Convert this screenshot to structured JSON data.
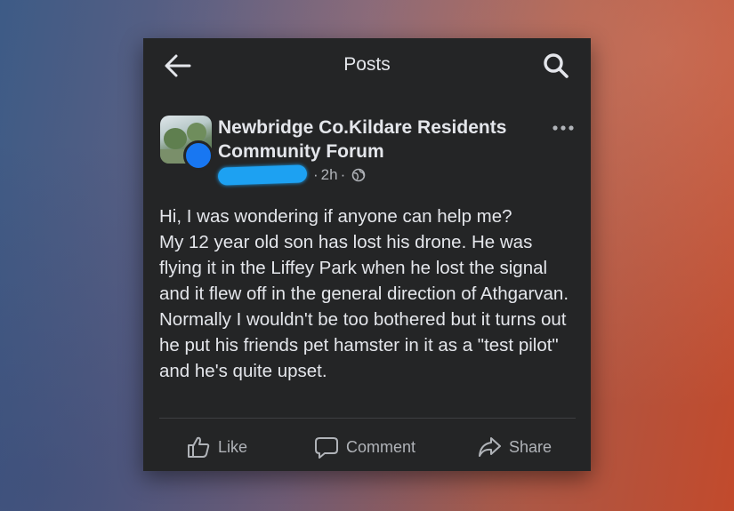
{
  "colors": {
    "card_bg": "#242526",
    "text_primary": "#e4e6eb",
    "text_secondary": "#b0b3b8",
    "accent_blue": "#1877f2",
    "redaction": "#1da1f2"
  },
  "header": {
    "back_icon": "arrow-left-icon",
    "title": "Posts",
    "search_icon": "search-icon"
  },
  "post": {
    "group_name": "Newbridge Co.Kildare Residents Community Forum",
    "more_icon": "more-horizontal-icon",
    "time": "2h",
    "privacy_icon": "globe-icon",
    "body": "Hi, I was wondering if anyone can help me?\nMy 12 year old son has lost his drone. He was flying it in the Liffey Park when he lost the signal and it flew off in the general direction of Athgarvan.\nNormally I wouldn't be too bothered but it turns out he put his friends pet hamster in it as a \"test pilot\" and he's quite upset."
  },
  "actions": {
    "like": "Like",
    "comment": "Comment",
    "share": "Share"
  }
}
